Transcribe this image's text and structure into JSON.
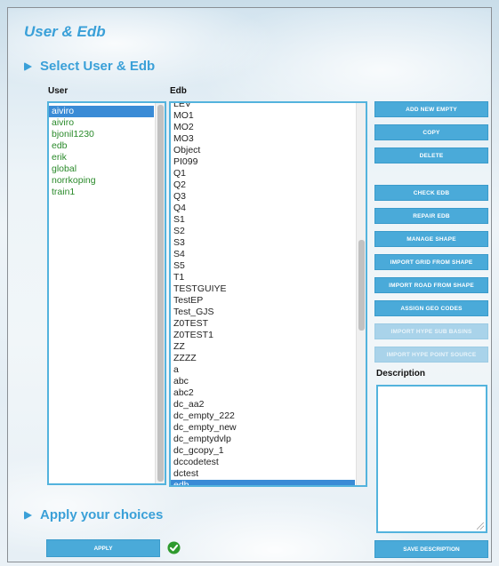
{
  "page": {
    "title": "User & Edb"
  },
  "sections": {
    "select_title": "Select User & Edb",
    "apply_title": "Apply your choices"
  },
  "user_list": {
    "label": "User",
    "items": [
      "aiviro",
      "aiviro",
      "bjonil1230",
      "edb",
      "erik",
      "global",
      "norrkoping",
      "train1"
    ],
    "selected_index": 0
  },
  "edb_list": {
    "label": "Edb",
    "items": [
      "LEV",
      "MO1",
      "MO2",
      "MO3",
      "Object",
      "PI099",
      "Q1",
      "Q2",
      "Q3",
      "Q4",
      "S1",
      "S2",
      "S3",
      "S4",
      "S5",
      "T1",
      "TESTGUIYE",
      "TestEP",
      "Test_GJS",
      "Z0TEST",
      "Z0TEST1",
      "ZZ",
      "ZZZZ",
      "a",
      "abc",
      "abc2",
      "dc_aa2",
      "dc_empty_222",
      "dc_empty_new",
      "dc_emptydvlp",
      "dc_gcopy_1",
      "dccodetest",
      "dctest",
      "edb"
    ],
    "selected_index": 33
  },
  "buttons": {
    "add_new_empty": "ADD NEW EMPTY",
    "copy": "COPY",
    "delete": "DELETE",
    "check_edb": "CHECK EDB",
    "repair_edb": "REPAIR EDB",
    "manage_shape": "MANAGE SHAPE",
    "import_grid": "IMPORT GRID FROM SHAPE",
    "import_road": "IMPORT ROAD FROM SHAPE",
    "assign_geo": "ASSIGN GEO CODES",
    "import_hype_sub": "IMPORT HYPE SUB BASINS",
    "import_hype_point": "IMPORT HYPE POINT SOURCE",
    "apply": "APPLY",
    "save_description": "SAVE DESCRIPTION"
  },
  "description": {
    "label": "Description",
    "value": ""
  },
  "colors": {
    "accent": "#3aa0d8",
    "button": "#4aaad9",
    "selected": "#3a8bd6",
    "user_text": "#2a8a2a",
    "success": "#2e9a2e"
  }
}
